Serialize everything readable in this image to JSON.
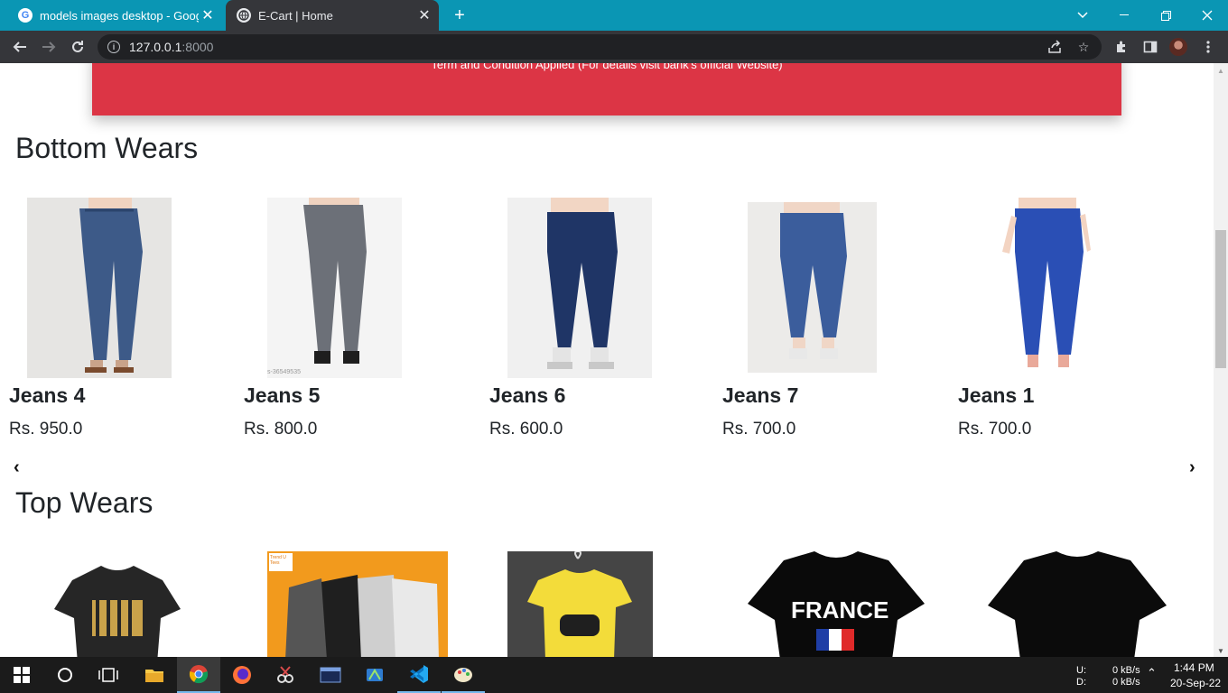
{
  "browser": {
    "tabs": [
      {
        "title": "models images desktop - Google",
        "favicon": "google-icon",
        "active": false
      },
      {
        "title": "E-Cart | Home",
        "favicon": "globe-icon",
        "active": true
      }
    ],
    "url_host": "127.0.0.1",
    "url_port": ":8000"
  },
  "page": {
    "banner_text": "Term and Condition Applied (For details visit bank's official Website)",
    "sections": [
      {
        "title": "Bottom Wears",
        "products": [
          {
            "name": "Jeans 4",
            "price": "Rs. 950.0"
          },
          {
            "name": "Jeans 5",
            "price": "Rs. 800.0",
            "image_code": "s-36549535"
          },
          {
            "name": "Jeans 6",
            "price": "Rs. 600.0"
          },
          {
            "name": "Jeans 7",
            "price": "Rs. 700.0"
          },
          {
            "name": "Jeans 1",
            "price": "Rs. 700.0"
          }
        ]
      },
      {
        "title": "Top Wears",
        "products": [
          {
            "name": "",
            "price": ""
          },
          {
            "name": "",
            "price": "",
            "image_logo": "Trend U Tees"
          },
          {
            "name": "",
            "price": ""
          },
          {
            "name": "",
            "price": "",
            "image_text": "FRANCE"
          },
          {
            "name": "",
            "price": ""
          }
        ]
      }
    ],
    "carousel": {
      "prev": "‹",
      "next": "›"
    }
  },
  "taskbar": {
    "net_up_label": "U:",
    "net_down_label": "D:",
    "net_up": "0 kB/s",
    "net_down": "0 kB/s",
    "time": "1:44 PM",
    "date": "20-Sep-22"
  },
  "colors": {
    "banner": "#dc3545",
    "tabstrip": "#0a96b4",
    "toolbar": "#35363a"
  }
}
